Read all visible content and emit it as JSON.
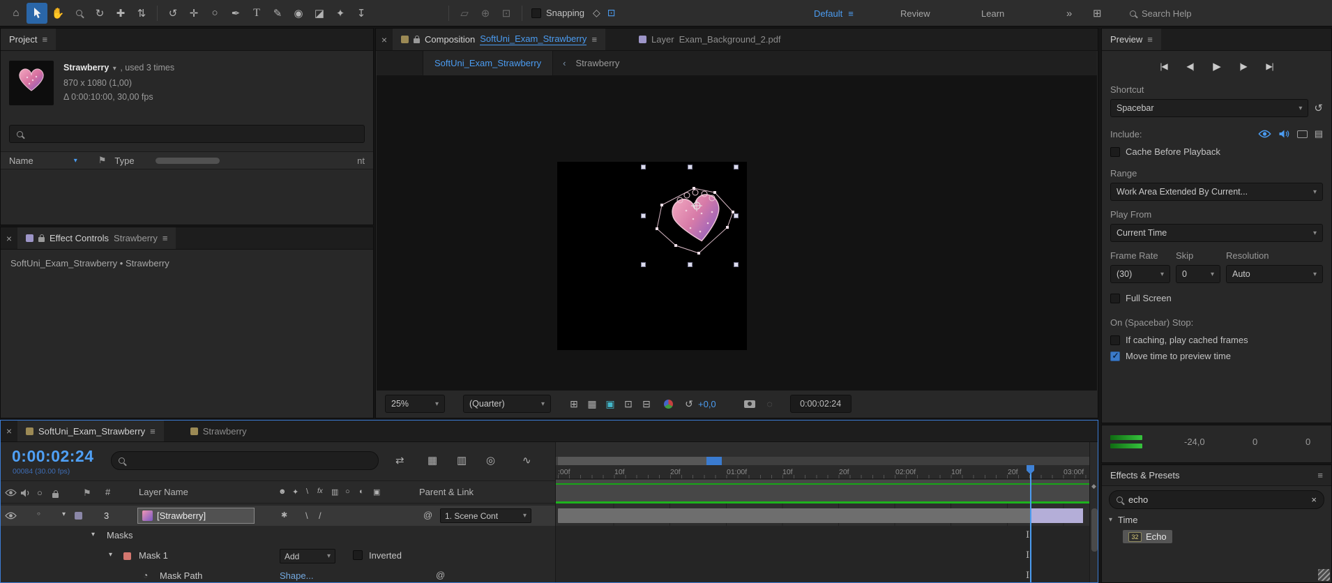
{
  "colors": {
    "accent_blue": "#4b9cf1",
    "timecode_blue": "#4fa0f6",
    "link_blue": "#74a9e0",
    "render_green": "#17a617",
    "lavender_bar": "#b4aed8",
    "mask_red": "#d4776f",
    "selected_tool_bg": "#2a66a8"
  },
  "glyphs": {
    "burger": "≡",
    "chevron_down": "▾",
    "twirl_open": "▾",
    "twirl_closed": "▸",
    "close": "×",
    "flag": "⚑",
    "pickwhip": "@",
    "stopwatch": "◔",
    "reset": "↺",
    "solo_circle": "○",
    "quality_backslash": "\\",
    "quality_slash": "/",
    "collapse_star": "✱",
    "crumb_chevron": "‹",
    "overflow": "»",
    "grid": "⊞",
    "snapshot_ghost": "◌",
    "marker_diamond": "◆",
    "keyframe_beam": "I",
    "cache_rows": "▤",
    "sort_arrow": "▾"
  },
  "toolbar": {
    "tools": [
      {
        "name": "home",
        "glyph": "⌂"
      },
      {
        "name": "selection",
        "glyph": "cursor-arrow"
      },
      {
        "name": "hand",
        "glyph": "✋"
      },
      {
        "name": "zo om",
        "glyph": "magnifier"
      },
      {
        "name": "orbit-camera",
        "glyph": "↻"
      },
      {
        "name": "pan-camera",
        "glyph": "✚"
      },
      {
        "name": "dolly-camera",
        "glyph": "⇅"
      },
      {
        "name": "rotation",
        "glyph": "↺"
      },
      {
        "name": "pan-behind",
        "glyph": "✛"
      },
      {
        "name": "shape",
        "glyph": "○"
      },
      {
        "name": "pen",
        "glyph": "✒"
      },
      {
        "name": "type",
        "glyph": "T"
      },
      {
        "name": "brush",
        "glyph": "✎"
      },
      {
        "name": "clone-stamp",
        "glyph": "◉"
      },
      {
        "name": "eraser",
        "glyph": "◪"
      },
      {
        "name": "roto-brush",
        "glyph": "✦"
      },
      {
        "name": "puppet-pin",
        "glyph": "↧"
      }
    ],
    "axis_tools": [
      {
        "name": "local-axis",
        "glyph": "▱"
      },
      {
        "name": "world-axis",
        "glyph": "⊕"
      },
      {
        "name": "view-axis",
        "glyph": "⊡"
      }
    ],
    "snap_icons": [
      {
        "name": "snap-edges",
        "glyph": "◇"
      },
      {
        "name": "snap-features",
        "glyph": "⊡"
      }
    ],
    "snapping_label": "Snapping",
    "workspace_default": "Default",
    "workspace_review": "Review",
    "workspace_learn": "Learn",
    "search_placeholder": "Search Help"
  },
  "project": {
    "tab": "Project",
    "item_name": "Strawberry",
    "item_usage": ", used 3 times",
    "item_dimensions": "870 x 1080 (1,00)",
    "item_duration": "Δ 0:00:10:00, 30,00 fps",
    "col_name": "Name",
    "col_type": "Type",
    "col_comment_fragment": "nt"
  },
  "effect_controls": {
    "title": "Effect Controls",
    "target": "Strawberry",
    "subtitle": "SoftUni_Exam_Strawberry • Strawberry"
  },
  "composition": {
    "tab_label": "Composition",
    "comp_name": "SoftUni_Exam_Strawberry",
    "layer_tab_label": "Layer",
    "layer_name": "Exam_Background_2.pdf",
    "viewer_tab": "SoftUni_Exam_Strawberry",
    "viewer_crumb": "Strawberry",
    "zoom_value": "25%",
    "resolution_value": "(Quarter)",
    "exposure_value": "+0,0",
    "timecode": "0:00:02:24",
    "view_icons": [
      {
        "name": "choose-grid-guides",
        "glyph": "⊞"
      },
      {
        "name": "transparency-grid",
        "glyph": "▦"
      },
      {
        "name": "mask-visibility",
        "glyph": "▣"
      },
      {
        "name": "region-of-interest",
        "glyph": "⊡"
      },
      {
        "name": "pixel-aspect",
        "glyph": "⊟"
      }
    ]
  },
  "preview": {
    "title": "Preview",
    "transport": [
      {
        "name": "first-frame",
        "glyph": "|◀"
      },
      {
        "name": "previous-frame",
        "glyph": "◀|"
      },
      {
        "name": "play",
        "glyph": "▶"
      },
      {
        "name": "next-frame",
        "glyph": "|▶"
      },
      {
        "name": "last-frame",
        "glyph": "▶|"
      }
    ],
    "shortcut_label": "Shortcut",
    "shortcut_value": "Spacebar",
    "include_label": "Include:",
    "cache_before_label": "Cache Before Playback",
    "range_label": "Range",
    "range_value": "Work Area Extended By Current...",
    "play_from_label": "Play From",
    "play_from_value": "Current Time",
    "frame_rate_label": "Frame Rate",
    "skip_label": "Skip",
    "resolution_label": "Resolution",
    "frame_rate_value": "(30)",
    "skip_value": "0",
    "resolution_value": "Auto",
    "full_screen_label": "Full Screen",
    "on_stop_label": "On (Spacebar) Stop:",
    "if_caching_label": "If caching, play cached frames",
    "move_time_label": "Move time to preview time"
  },
  "audio": {
    "level_db": "-24,0",
    "slider_left": "0",
    "slider_right": "0"
  },
  "effects_presets": {
    "title": "Effects & Presets",
    "search_value": "echo",
    "category": "Time",
    "effect_name": "Echo",
    "effect_badge": "32"
  },
  "timeline": {
    "tab_active": "SoftUni_Exam_Strawberry",
    "tab_inactive": "Strawberry",
    "timecode": "0:00:02:24",
    "frame_info": "00084 (30.00 fps)",
    "col_hash": "#",
    "col_layer_name": "Layer Name",
    "col_parent": "Parent & Link",
    "layer_index": "3",
    "layer_name": "[Strawberry]",
    "parent_value": "1. Scene Cont",
    "masks_label": "Masks",
    "mask_name": "Mask 1",
    "mask_mode": "Add",
    "inverted_label": "Inverted",
    "mask_path_label": "Mask Path",
    "mask_path_value": "Shape...",
    "ruler_labels": [
      ":00f",
      "10f",
      "20f",
      "01:00f",
      "10f",
      "20f",
      "02:00f",
      "10f",
      "20f",
      "03:00f"
    ],
    "tl_icons": [
      {
        "name": "comp-mini-flowchart",
        "glyph": "⇄"
      },
      {
        "name": "draft-3d",
        "glyph": "▦"
      },
      {
        "name": "frame-blending",
        "glyph": "▥"
      },
      {
        "name": "motion-blur",
        "glyph": "◎"
      },
      {
        "name": "graph-editor",
        "glyph": "∿"
      }
    ],
    "switch_icons": [
      {
        "name": "shy",
        "glyph": "☻"
      },
      {
        "name": "collapse",
        "glyph": "✦"
      },
      {
        "name": "quality",
        "glyph": "\\"
      },
      {
        "name": "fx",
        "glyph": "fx"
      },
      {
        "name": "frame-blend",
        "glyph": "▥"
      },
      {
        "name": "motion-blur",
        "glyph": "○"
      },
      {
        "name": "adjustment",
        "glyph": "◐"
      },
      {
        "name": "threed",
        "glyph": "▣"
      }
    ]
  }
}
